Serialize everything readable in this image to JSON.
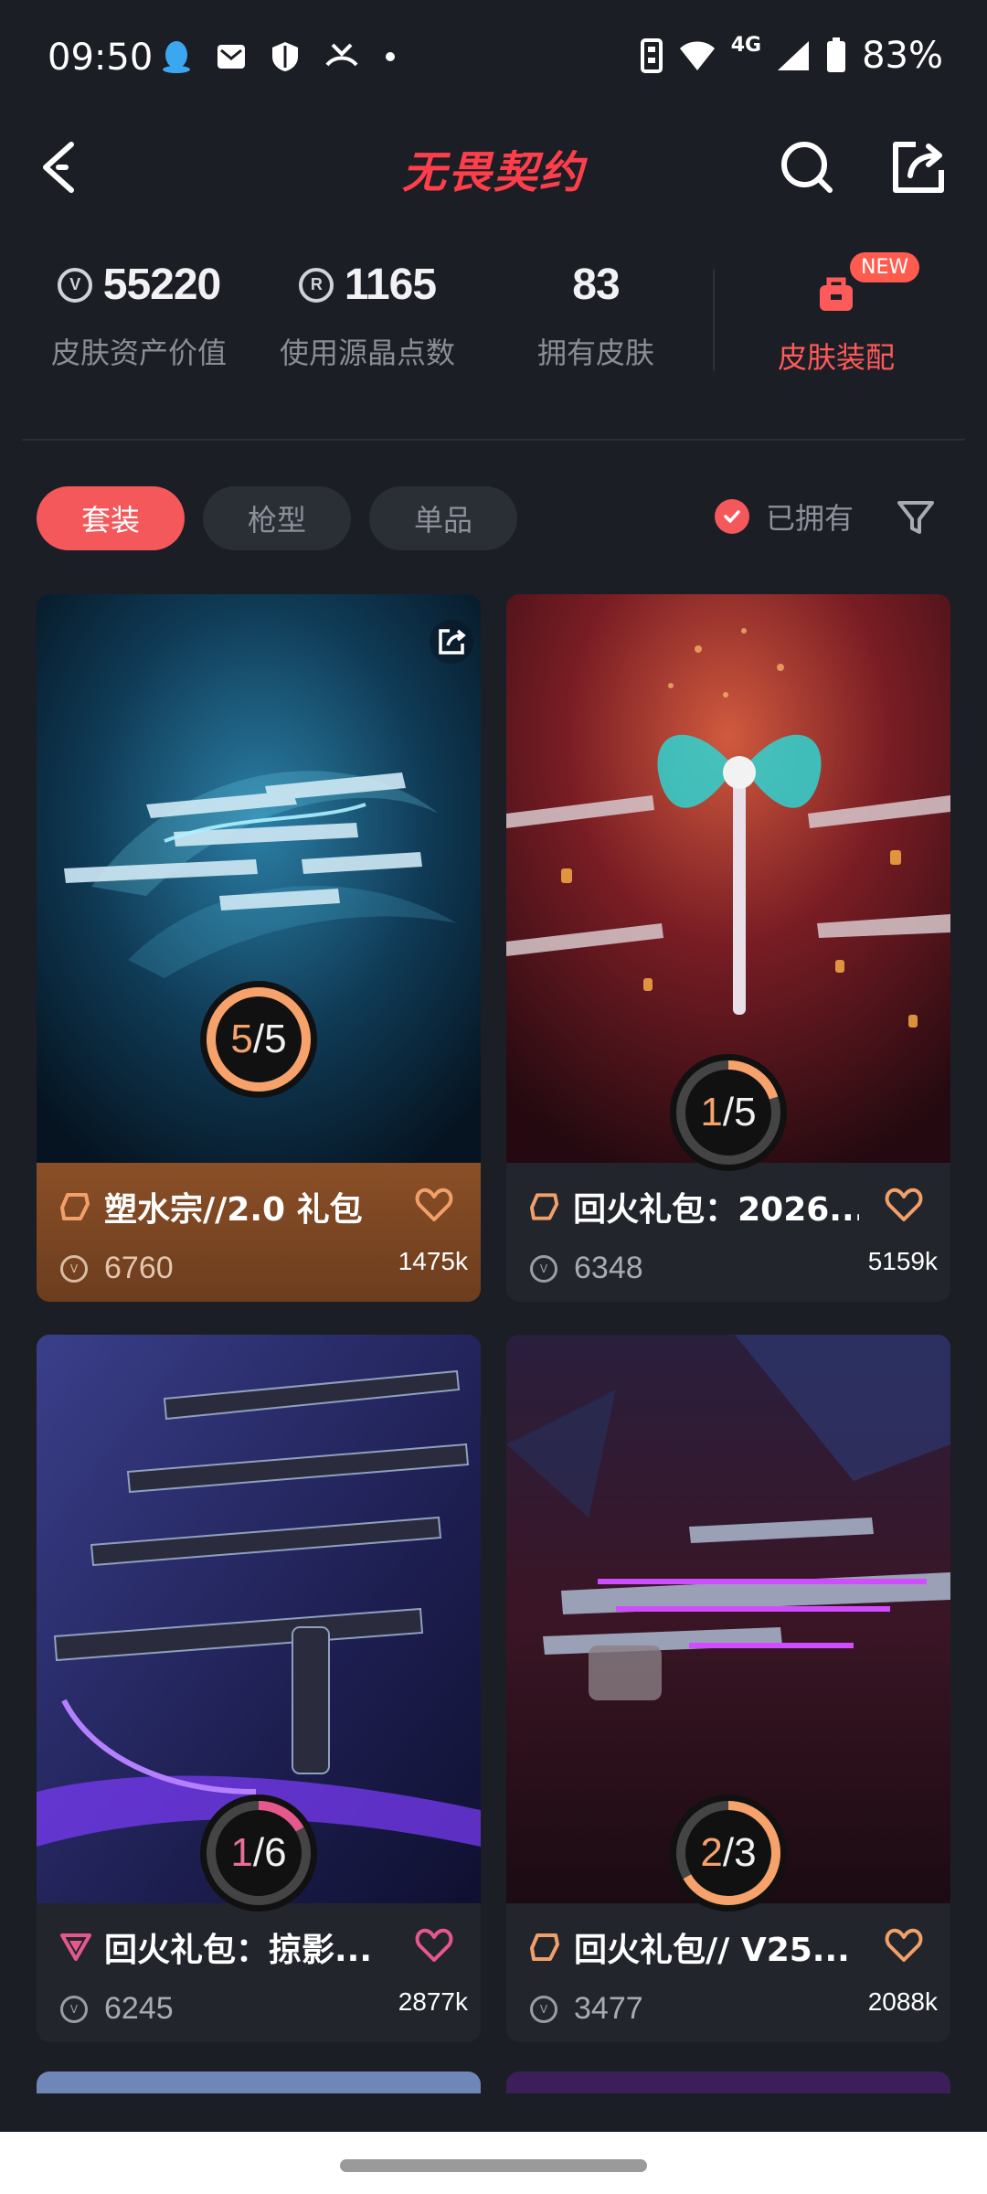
{
  "status_bar": {
    "time": "09:50",
    "network": "4G",
    "battery": "83%"
  },
  "app": {
    "logo_text": "无畏契约"
  },
  "stats": [
    {
      "value": "55220",
      "label": "皮肤资产价值",
      "icon": "vp-coin-icon"
    },
    {
      "value": "1165",
      "label": "使用源晶点数",
      "icon": "radianite-icon"
    },
    {
      "value": "83",
      "label": "拥有皮肤",
      "icon": ""
    }
  ],
  "outfit": {
    "label": "皮肤装配",
    "badge": "NEW"
  },
  "filters": {
    "tabs": [
      {
        "label": "套装",
        "active": true
      },
      {
        "label": "枪型",
        "active": false
      },
      {
        "label": "单品",
        "active": false
      }
    ],
    "owned_label": "已拥有"
  },
  "cards": [
    {
      "name": "塑水宗//2.0 礼包",
      "price": "6760",
      "count": "1475k",
      "owned": "5",
      "total": "5",
      "tier_icon": "tier-exclusive-icon",
      "tier_color": "#f2a06a"
    },
    {
      "name": "回火礼包：2026...",
      "price": "6348",
      "count": "5159k",
      "owned": "1",
      "total": "5",
      "tier_icon": "tier-exclusive-icon",
      "tier_color": "#f2a06a"
    },
    {
      "name": "回火礼包：掠影...",
      "price": "6245",
      "count": "2877k",
      "owned": "1",
      "total": "6",
      "tier_icon": "tier-ultra-icon",
      "tier_color": "#e6588d"
    },
    {
      "name": "回火礼包// V25...",
      "price": "3477",
      "count": "2088k",
      "owned": "2",
      "total": "3",
      "tier_icon": "tier-exclusive-icon",
      "tier_color": "#f2a06a"
    }
  ],
  "colors": {
    "accent": "#f4585b",
    "background": "#1b1e24",
    "ring": "#f6a26a"
  }
}
